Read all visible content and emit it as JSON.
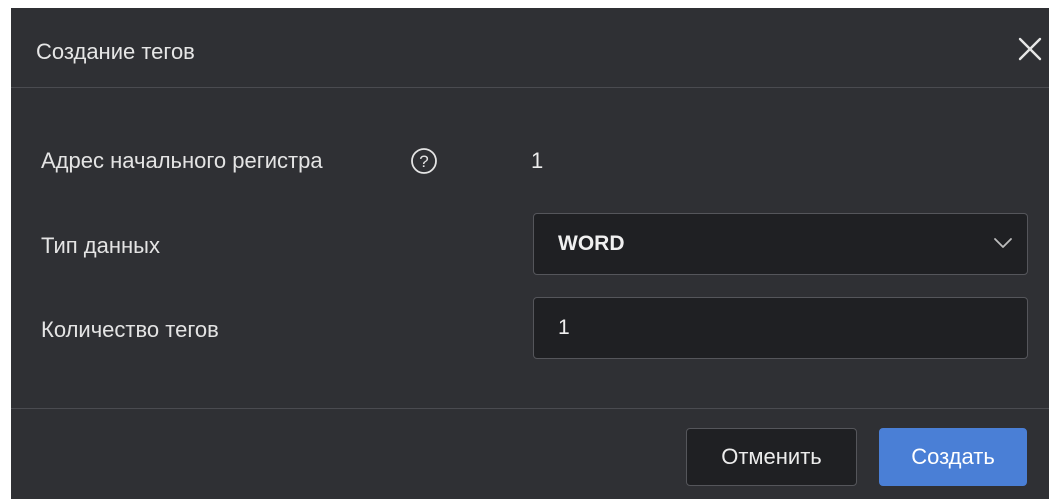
{
  "dialog": {
    "title": "Создание тегов",
    "close_icon": "close-icon"
  },
  "form": {
    "start_address_label": "Адрес начального регистра",
    "start_address_help_icon": "question-circle-icon",
    "start_address_value": "1",
    "data_type_label": "Тип данных",
    "data_type_value": "WORD",
    "data_type_icon": "chevron-down-icon",
    "tag_count_label": "Количество тегов",
    "tag_count_value": "1"
  },
  "footer": {
    "cancel_label": "Отменить",
    "create_label": "Создать"
  },
  "colors": {
    "dialog_bg": "#2f3034",
    "field_bg": "#1f2023",
    "primary": "#4a7fd6"
  }
}
